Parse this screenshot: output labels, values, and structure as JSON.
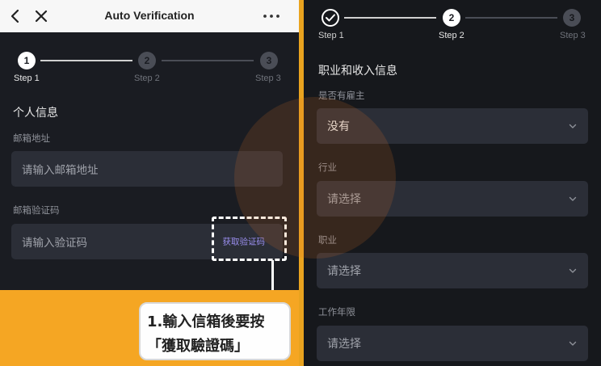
{
  "left_panel": {
    "header": {
      "title": "Auto Verification",
      "back_icon": "chevron-left-icon",
      "close_icon": "close-icon",
      "more_icon": "more-horizontal-icon"
    },
    "stepper": {
      "steps": [
        {
          "number": "1",
          "label": "Step 1",
          "state": "active"
        },
        {
          "number": "2",
          "label": "Step 2",
          "state": "pending"
        },
        {
          "number": "3",
          "label": "Step 3",
          "state": "pending"
        }
      ]
    },
    "section_title": "个人信息",
    "email": {
      "label": "邮箱地址",
      "placeholder": "请输入邮箱地址"
    },
    "code": {
      "label": "邮箱验证码",
      "placeholder": "请输入验证码",
      "get_code_label": "获取验证码"
    },
    "callout": {
      "line1": "1.輸入信箱後要按",
      "line2": "「獲取驗證碼」"
    }
  },
  "right_panel": {
    "stepper": {
      "steps": [
        {
          "number": "✓",
          "label": "Step 1",
          "state": "done"
        },
        {
          "number": "2",
          "label": "Step 2",
          "state": "active"
        },
        {
          "number": "3",
          "label": "Step 3",
          "state": "pending"
        }
      ]
    },
    "section_title": "职业和收入信息",
    "fields": [
      {
        "label": "是否有雇主",
        "value": "没有",
        "is_placeholder": false
      },
      {
        "label": "行业",
        "value": "请选择",
        "is_placeholder": true
      },
      {
        "label": "职业",
        "value": "请选择",
        "is_placeholder": true
      },
      {
        "label": "工作年限",
        "value": "请选择",
        "is_placeholder": true
      }
    ]
  },
  "colors": {
    "accent_link": "#9b8ff0",
    "banner_orange": "#f5a623",
    "panel_bg": "#1a1c22",
    "input_bg": "#2b2e37"
  }
}
